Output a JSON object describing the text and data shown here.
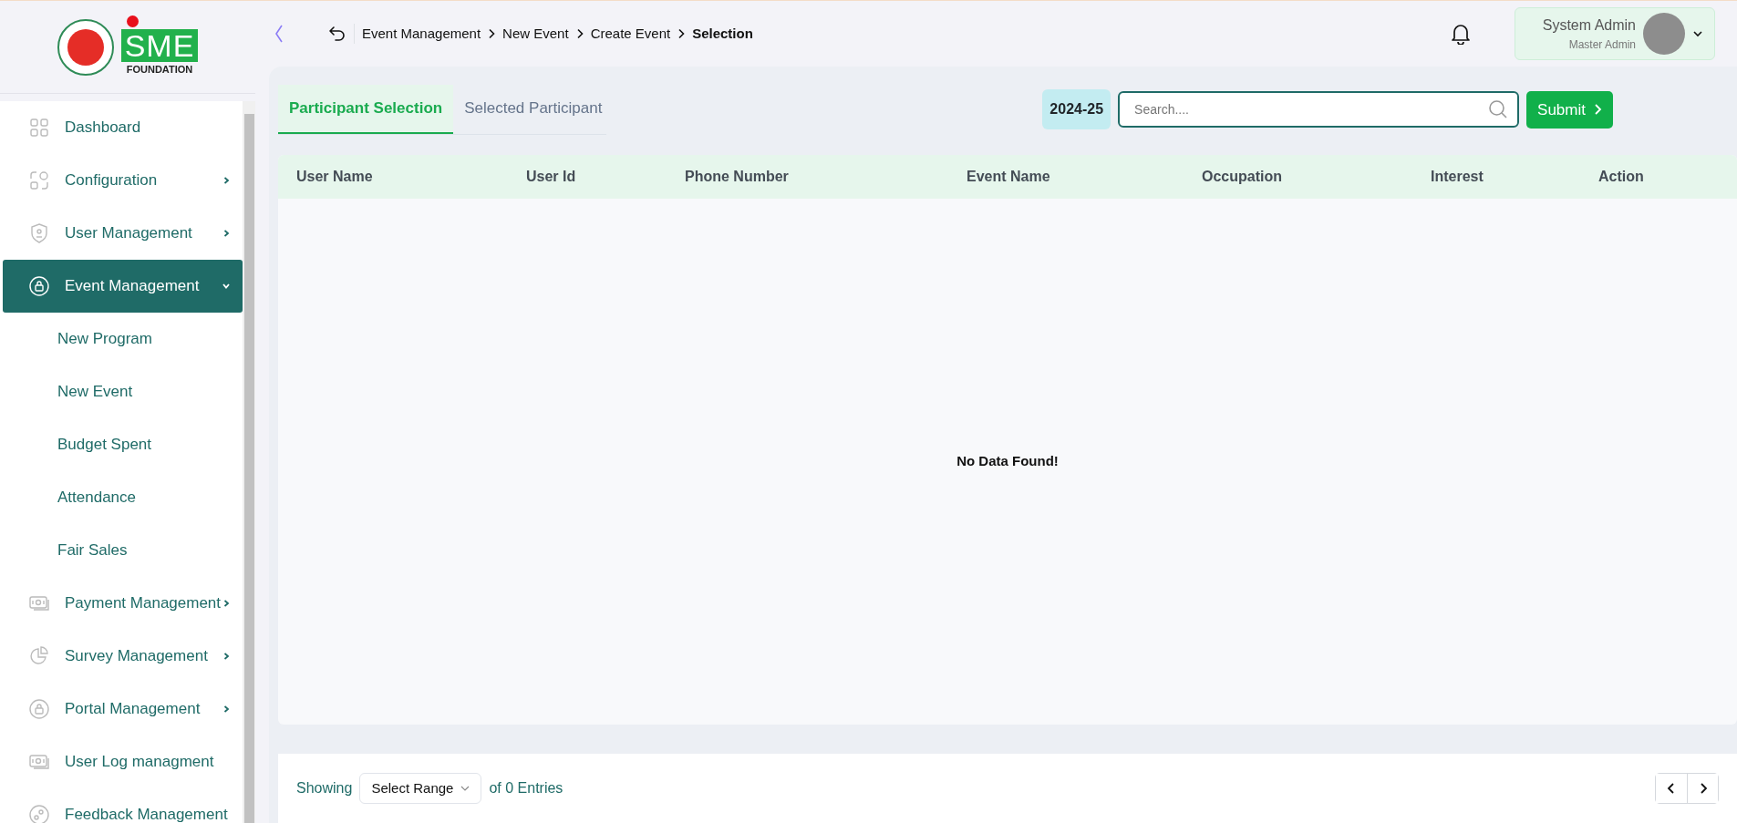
{
  "logo": {
    "mark": "SME",
    "caption": "FOUNDATION"
  },
  "sidebar": {
    "items": [
      {
        "label": "Dashboard",
        "selected": false
      },
      {
        "label": "Configuration",
        "selected": false,
        "expanded": false
      },
      {
        "label": "User Management",
        "selected": false,
        "expanded": false
      },
      {
        "label": "Event Management",
        "selected": true,
        "expanded": true,
        "children": [
          {
            "label": "New Program"
          },
          {
            "label": "New Event"
          },
          {
            "label": "Budget Spent"
          },
          {
            "label": "Attendance"
          },
          {
            "label": "Fair Sales"
          }
        ]
      },
      {
        "label": "Payment Management",
        "selected": false,
        "expanded": false
      },
      {
        "label": "Survey Management",
        "selected": false,
        "expanded": false
      },
      {
        "label": "Portal Management",
        "selected": false,
        "expanded": false
      },
      {
        "label": "User Log managment",
        "selected": false
      },
      {
        "label": "Feedback Management",
        "selected": false
      }
    ]
  },
  "breadcrumb": [
    "Event Management",
    "New Event",
    "Create Event",
    "Selection"
  ],
  "user": {
    "name": "System Admin",
    "role": "Master Admin"
  },
  "tabs": [
    {
      "label": "Participant Selection",
      "selected": true
    },
    {
      "label": "Selected Participant",
      "selected": false
    }
  ],
  "fiscal_year": "2024-25",
  "search": {
    "placeholder": "Search...."
  },
  "submit_button": "Submit",
  "table": {
    "columns": [
      "User Name",
      "User Id",
      "Phone Number",
      "Event Name",
      "Occupation",
      "Interest",
      "Action"
    ],
    "empty_message": "No Data Found!"
  },
  "footer": {
    "showing": "Showing",
    "range_select": "Select Range",
    "entries": "of 0 Entries"
  }
}
